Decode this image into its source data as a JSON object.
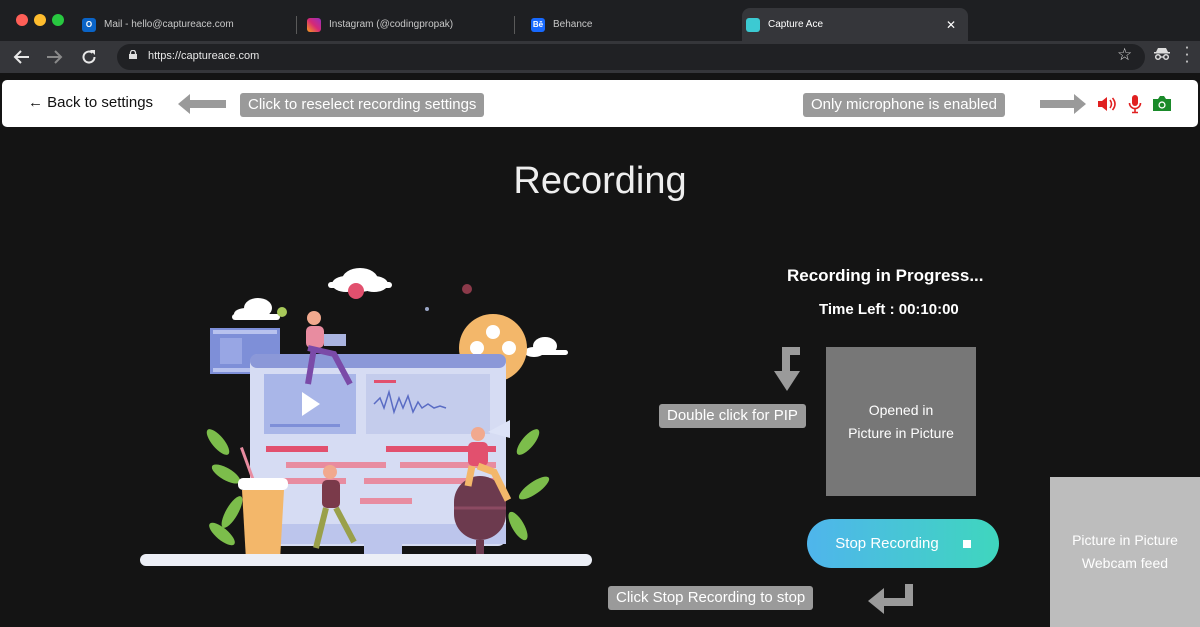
{
  "browser": {
    "tabs": [
      {
        "label": "Mail - hello@captureace.com",
        "icon": "outlook-icon"
      },
      {
        "label": "Instagram (@codingpropak)",
        "icon": "instagram-icon"
      },
      {
        "label": "Behance",
        "icon": "behance-icon",
        "icon_text": "Bē"
      },
      {
        "label": "Capture Ace",
        "icon": "captureace-icon",
        "close": "✕"
      }
    ],
    "url": "https://captureace.com"
  },
  "topbar": {
    "back_label": "← Back to settings",
    "reselect_hint": "Click to reselect recording settings",
    "mic_hint": "Only microphone is enabled",
    "icons": [
      "speaker-icon",
      "microphone-icon",
      "camera-icon"
    ],
    "colors": {
      "speaker": "#e02020",
      "mic": "#e02020",
      "camera": "#1a8a2a"
    }
  },
  "main": {
    "title": "Recording",
    "status": "Recording in Progress...",
    "time_left": "Time Left : 00:10:00",
    "pip_hint": "Double click for PIP",
    "pip_box_line1": "Opened in",
    "pip_box_line2": "Picture in Picture",
    "stop_label": "Stop Recording",
    "stop_hint": "Click Stop Recording to stop",
    "webcam_line1": "Picture in Picture",
    "webcam_line2": "Webcam feed"
  }
}
